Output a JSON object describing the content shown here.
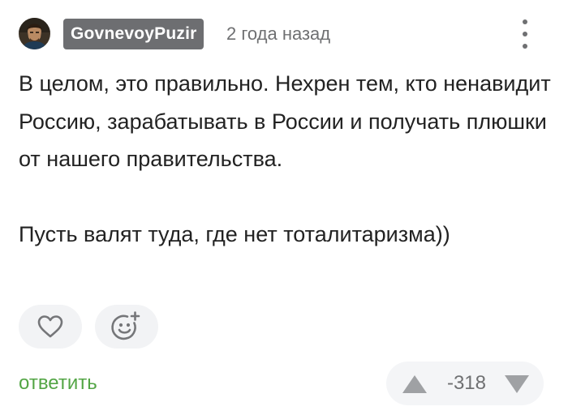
{
  "comment": {
    "author": {
      "username": "GovnevoyPuzir",
      "avatar_icon": "user-avatar"
    },
    "timestamp": "2 года назад",
    "body": {
      "paragraph1": "В целом, это правильно. Нехрен тем, кто ненавидит Россию, зарабатывать в России и получать плюшки от нашего правительства.",
      "paragraph2": "Пусть валят туда, где нет тоталитаризма))"
    },
    "actions": {
      "like_icon": "heart-icon",
      "reaction_icon": "add-emoji-icon",
      "reply_label": "ответить"
    },
    "rating": {
      "value": "-318",
      "up_icon": "triangle-up-icon",
      "down_icon": "triangle-down-icon"
    }
  },
  "colors": {
    "username_badge": "#6d6e71",
    "reply_link": "#53a545",
    "muted_text": "#6f7072",
    "button_background": "#f2f3f5",
    "icon_stroke": "#757679",
    "vote_arrows": "#9fa1a4"
  }
}
